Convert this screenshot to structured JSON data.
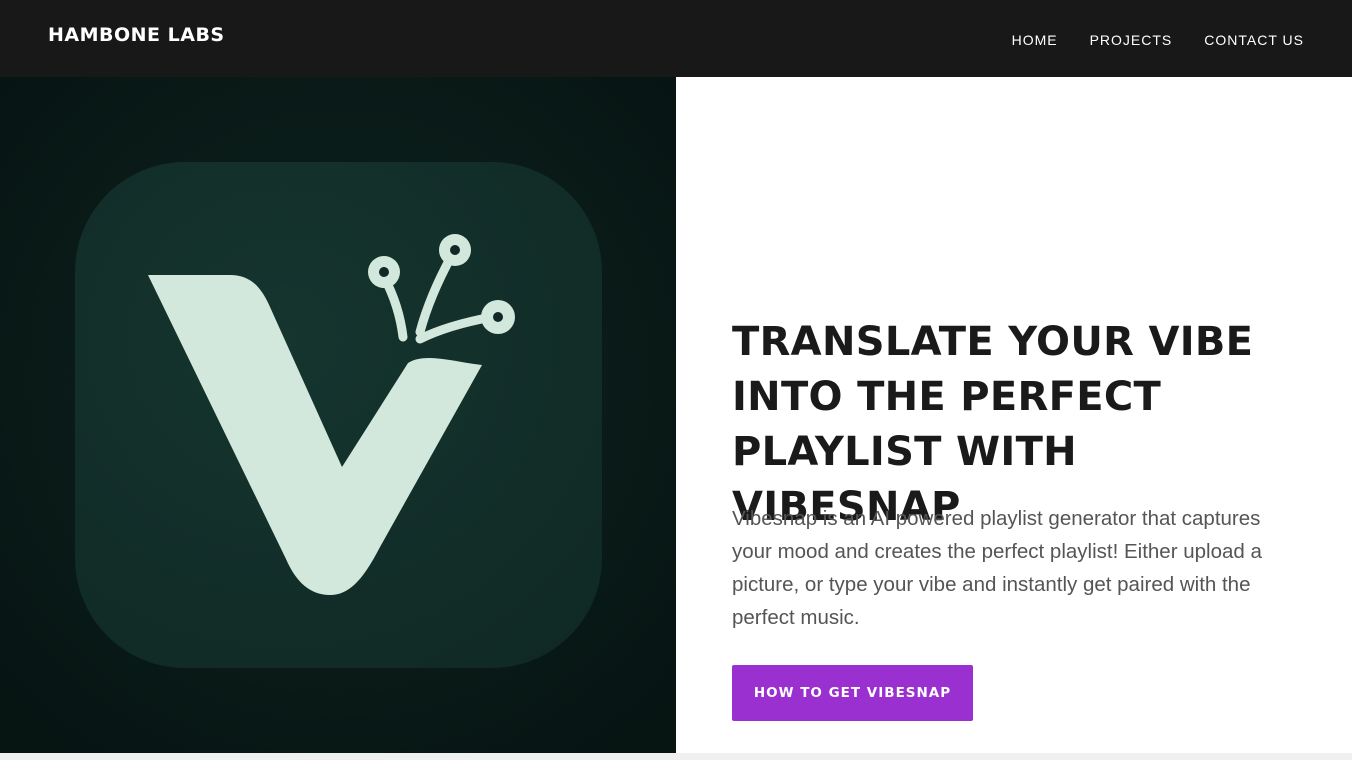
{
  "header": {
    "brand": "HAMBONE LABS",
    "nav": [
      {
        "label": "HOME"
      },
      {
        "label": "PROJECTS"
      },
      {
        "label": "CONTACT US"
      }
    ]
  },
  "hero": {
    "image": {
      "icon": "vibesnap-app-icon",
      "colors": {
        "background": "#081816",
        "tile": "#13302b",
        "logo": "#d3e8dc"
      }
    },
    "headline": "TRANSLATE YOUR VIBE INTO THE PERFECT PLAYLIST WITH VIBESNAP",
    "description": "Vibesnap is an AI powered playlist generator that captures your mood and creates the perfect playlist! Either upload a picture, or type your vibe and instantly get paired with the perfect music.",
    "cta": {
      "label": "HOW TO GET VIBESNAP",
      "color": "#9b30d0"
    }
  }
}
